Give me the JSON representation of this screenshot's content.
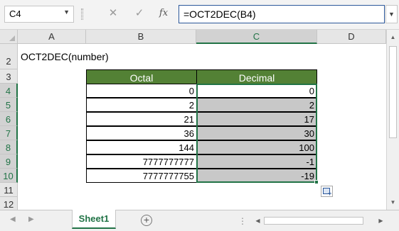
{
  "formula_bar": {
    "name_box": "C4",
    "cancel_icon": "✕",
    "enter_icon": "✓",
    "fx_label": "fx",
    "formula": "=OCT2DEC(B4)"
  },
  "columns": [
    "A",
    "B",
    "C",
    "D"
  ],
  "selected_column": "C",
  "rows": [
    "2",
    "3",
    "4",
    "5",
    "6",
    "7",
    "8",
    "9",
    "10",
    "11",
    "12"
  ],
  "selected_rows": [
    "4",
    "5",
    "6",
    "7",
    "8",
    "9",
    "10"
  ],
  "sheet": {
    "title": "OCT2DEC(number)",
    "table": {
      "headers": [
        "Octal",
        "Decimal"
      ],
      "header_color": "#538135",
      "rows": [
        {
          "octal": "0",
          "decimal": "0"
        },
        {
          "octal": "2",
          "decimal": "2"
        },
        {
          "octal": "21",
          "decimal": "17"
        },
        {
          "octal": "36",
          "decimal": "30"
        },
        {
          "octal": "144",
          "decimal": "100"
        },
        {
          "octal": "7777777777",
          "decimal": "-1"
        },
        {
          "octal": "7777777755",
          "decimal": "-19"
        }
      ]
    }
  },
  "tabs": {
    "active": "Sheet1",
    "prev_icon": "◀",
    "next_icon": "▶",
    "add_icon": "+"
  },
  "colors": {
    "accent": "#217346",
    "selection_fill": "#c8c8c8"
  }
}
